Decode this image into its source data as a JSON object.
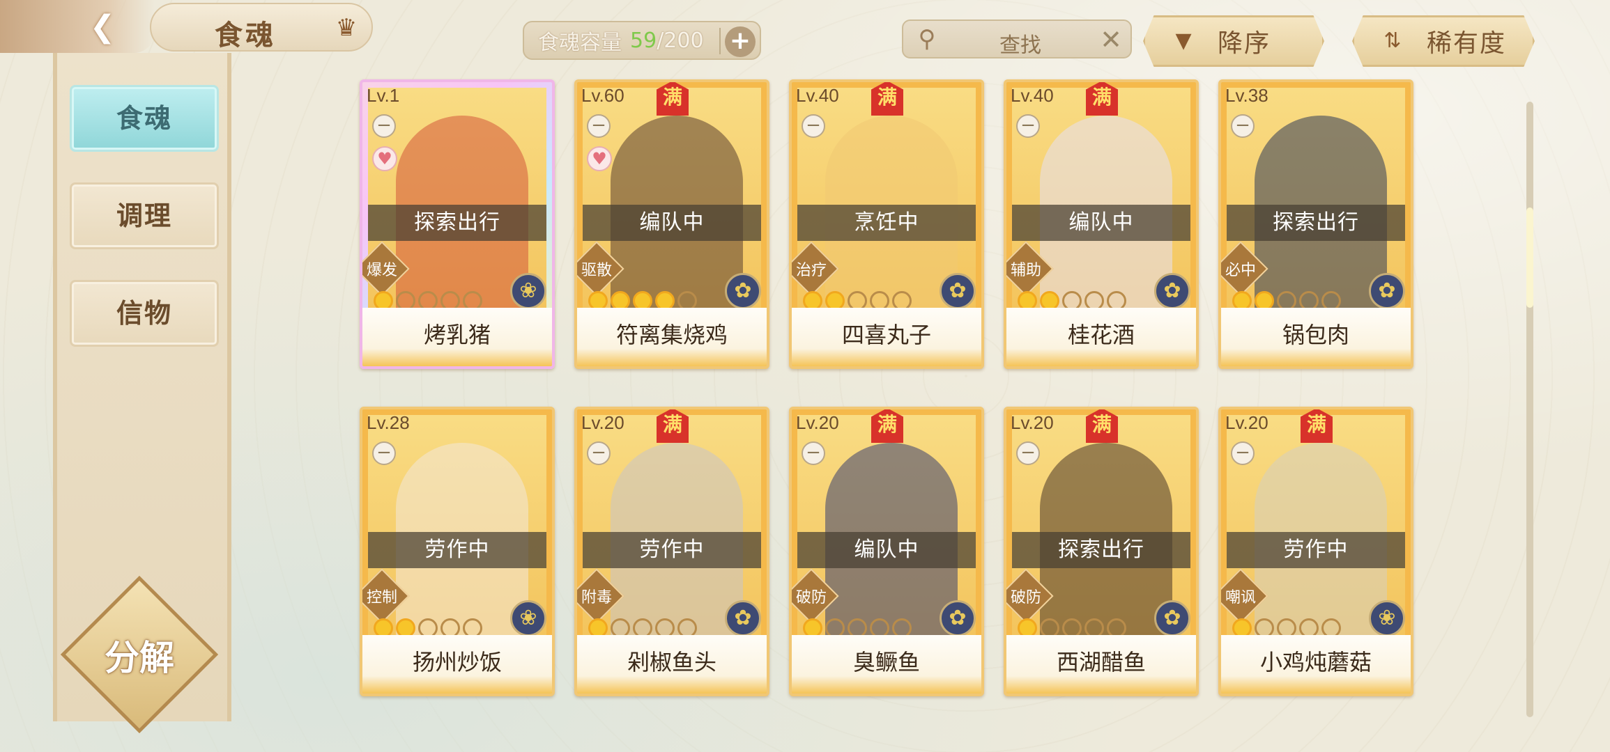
{
  "header": {
    "back_icon": "back-arrow-icon",
    "title": "食魂",
    "crown_icon": "crown-icon",
    "capacity": {
      "label": "食魂容量",
      "current": "59",
      "total": "/200",
      "plus": "+"
    },
    "search": {
      "placeholder": "查找",
      "clear": "✕"
    },
    "sort_order": "降序",
    "sort_key": "稀有度"
  },
  "sidebar": {
    "tabs": [
      {
        "label": "食魂",
        "active": true
      },
      {
        "label": "调理",
        "active": false
      },
      {
        "label": "信物",
        "active": false
      }
    ],
    "decompose": "分解"
  },
  "colors": {
    "accent_teal": "#8fd6d8",
    "card_gold": "#f5b94b",
    "full_badge_red": "#d8322a"
  },
  "cards": [
    {
      "level": "Lv.1",
      "full": false,
      "heart": true,
      "status": "探索出行",
      "role": "爆发",
      "flames": 1,
      "element": "blue",
      "name": "烤乳猪",
      "rainbow": true
    },
    {
      "level": "Lv.60",
      "full": true,
      "full_label": "满",
      "heart": true,
      "status": "编队中",
      "role": "驱散",
      "flames": 4,
      "element": "gold",
      "name": "符离集烧鸡"
    },
    {
      "level": "Lv.40",
      "full": true,
      "full_label": "满",
      "heart": false,
      "status": "烹饪中",
      "role": "治疗",
      "flames": 2,
      "element": "gold",
      "name": "四喜丸子"
    },
    {
      "level": "Lv.40",
      "full": true,
      "full_label": "满",
      "heart": false,
      "status": "编队中",
      "role": "辅助",
      "flames": 2,
      "element": "gold",
      "name": "桂花酒"
    },
    {
      "level": "Lv.38",
      "full": false,
      "heart": false,
      "status": "探索出行",
      "role": "必中",
      "flames": 2,
      "element": "gold",
      "name": "锅包肉"
    },
    {
      "level": "Lv.28",
      "full": false,
      "heart": false,
      "status": "劳作中",
      "role": "控制",
      "flames": 2,
      "element": "blue",
      "name": "扬州炒饭"
    },
    {
      "level": "Lv.20",
      "full": true,
      "full_label": "满",
      "heart": false,
      "status": "劳作中",
      "role": "附毒",
      "flames": 1,
      "element": "gold",
      "name": "剁椒鱼头"
    },
    {
      "level": "Lv.20",
      "full": true,
      "full_label": "满",
      "heart": false,
      "status": "编队中",
      "role": "破防",
      "flames": 1,
      "element": "gold",
      "name": "臭鳜鱼"
    },
    {
      "level": "Lv.20",
      "full": true,
      "full_label": "满",
      "heart": false,
      "status": "探索出行",
      "role": "破防",
      "flames": 1,
      "element": "gold",
      "name": "西湖醋鱼"
    },
    {
      "level": "Lv.20",
      "full": true,
      "full_label": "满",
      "heart": false,
      "status": "劳作中",
      "role": "嘲讽",
      "flames": 1,
      "element": "blue",
      "name": "小鸡炖蘑菇"
    }
  ]
}
